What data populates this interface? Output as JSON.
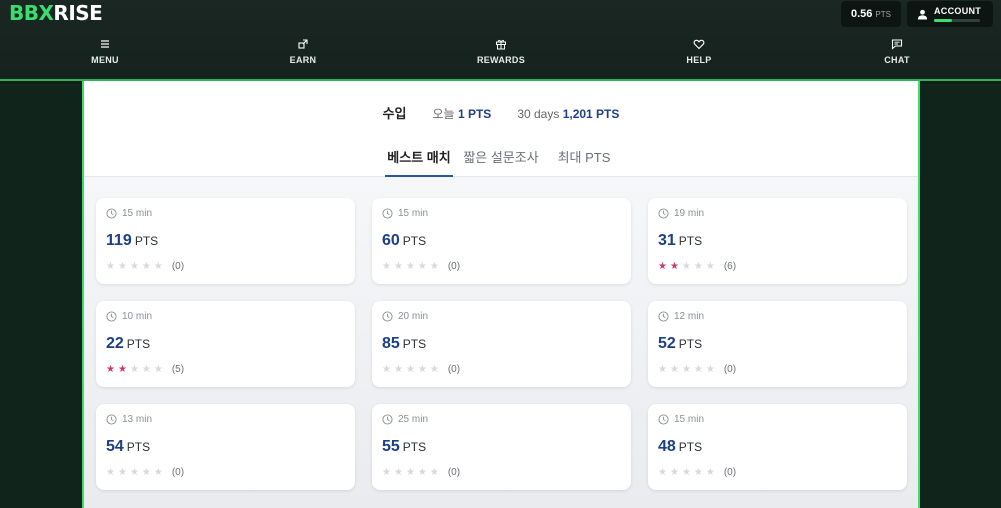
{
  "header": {
    "logo_part1": "BBX",
    "logo_part2": "RISE",
    "points_value": "0.56",
    "points_unit": "PTS",
    "account_label": "ACCOUNT",
    "account_progress": 0.4
  },
  "nav": {
    "items": [
      {
        "label": "MENU",
        "icon": "menu-icon"
      },
      {
        "label": "EARN",
        "icon": "earn-icon"
      },
      {
        "label": "REWARDS",
        "icon": "gift-icon"
      },
      {
        "label": "HELP",
        "icon": "help-icon"
      },
      {
        "label": "CHAT",
        "icon": "chat-icon"
      }
    ]
  },
  "earnings": {
    "label": "수입",
    "today_label": "오늘",
    "today_value": "1 PTS",
    "period_label": "30 days",
    "period_value": "1,201 PTS"
  },
  "tabs": [
    {
      "label": "베스트 매치",
      "active": true
    },
    {
      "label": "짧은 설문조사",
      "active": false
    },
    {
      "label": "최대 PTS",
      "active": false
    }
  ],
  "surveys": [
    {
      "time": "15 min",
      "points": "119",
      "unit": "PTS",
      "stars": 0,
      "count": "(0)"
    },
    {
      "time": "15 min",
      "points": "60",
      "unit": "PTS",
      "stars": 0,
      "count": "(0)"
    },
    {
      "time": "19 min",
      "points": "31",
      "unit": "PTS",
      "stars": 2,
      "count": "(6)"
    },
    {
      "time": "10 min",
      "points": "22",
      "unit": "PTS",
      "stars": 2,
      "count": "(5)"
    },
    {
      "time": "20 min",
      "points": "85",
      "unit": "PTS",
      "stars": 0,
      "count": "(0)"
    },
    {
      "time": "12 min",
      "points": "52",
      "unit": "PTS",
      "stars": 0,
      "count": "(0)"
    },
    {
      "time": "13 min",
      "points": "54",
      "unit": "PTS",
      "stars": 0,
      "count": "(0)"
    },
    {
      "time": "25 min",
      "points": "55",
      "unit": "PTS",
      "stars": 0,
      "count": "(0)"
    },
    {
      "time": "15 min",
      "points": "48",
      "unit": "PTS",
      "stars": 0,
      "count": "(0)"
    }
  ],
  "colors": {
    "accent_green": "#3ddc6f",
    "points_blue": "#1c3f86",
    "star_on": "#d1396b"
  }
}
